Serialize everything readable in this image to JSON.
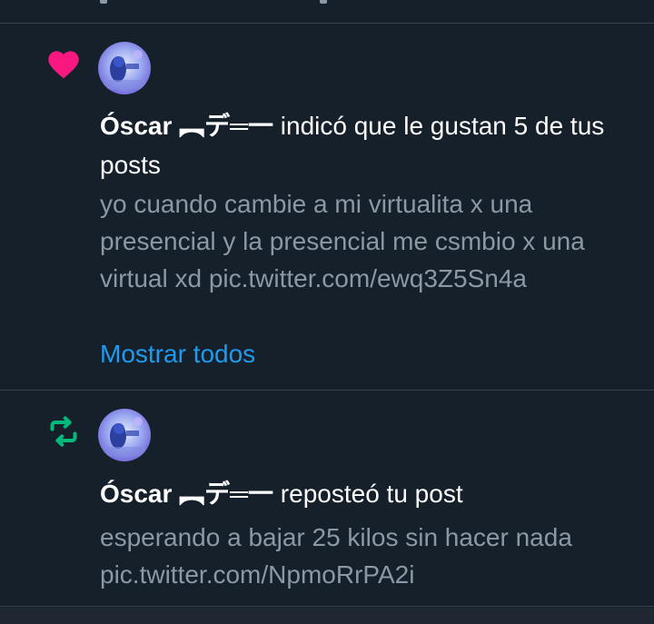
{
  "notifications": [
    {
      "type_icon": "heart-icon",
      "type_color": "#f91880",
      "user_name": "Óscar ︻デ═一",
      "action_text": " indicó que le gustan 5 de tus posts",
      "post_text": "yo cuando cambie a mi virtualita x una presencial y la presencial me csmbio x una virtual xd pic.twitter.com/ewq3Z5Sn4a",
      "show_all_label": "Mostrar todos"
    },
    {
      "type_icon": "repost-icon",
      "type_color": "#00ba7c",
      "user_name": "Óscar ︻デ═一",
      "action_text": " reposteó tu post",
      "post_text": "esperando a bajar 25 kilos sin hacer nada pic.twitter.com/NpmoRrPA2i"
    }
  ],
  "colors": {
    "background": "#15202b",
    "divider": "#38444d",
    "secondary_text": "#8b98a5",
    "link": "#1d9bf0"
  }
}
